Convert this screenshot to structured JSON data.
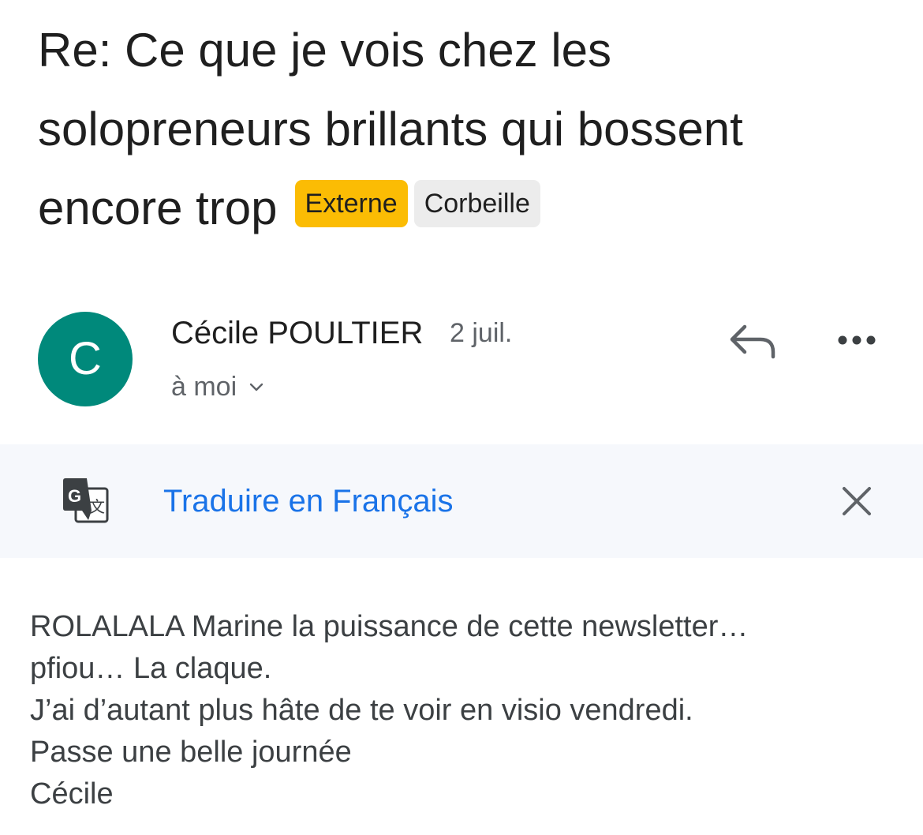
{
  "email": {
    "subject": "Re: Ce que je vois chez les solopreneurs brillants qui bossent encore trop",
    "labels": {
      "externe": "Externe",
      "corbeille": "Corbeille"
    },
    "sender": {
      "avatar_letter": "C",
      "name": "Cécile POULTIER",
      "date": "2 juil.",
      "recipient": "à moi"
    },
    "translate": {
      "link": "Traduire en Français"
    },
    "body": {
      "lines": [
        "ROLALALA Marine la puissance de cette newsletter…",
        "pfiou… La claque.",
        "J’ai d’autant plus hâte de te voir en visio vendredi.",
        "Passe une belle journée",
        "Cécile"
      ]
    }
  },
  "icons": {
    "reply": "reply-icon",
    "more": "more-horizontal-icon",
    "recipient_chevron": "chevron-down-icon",
    "translate": "google-translate-icon",
    "close": "close-icon"
  },
  "colors": {
    "avatar": "#00897b",
    "externe_chip": "#fbbc04",
    "corbeille_chip": "#ececec",
    "link": "#1a73e8",
    "translate_bar": "#f6f8fc"
  }
}
